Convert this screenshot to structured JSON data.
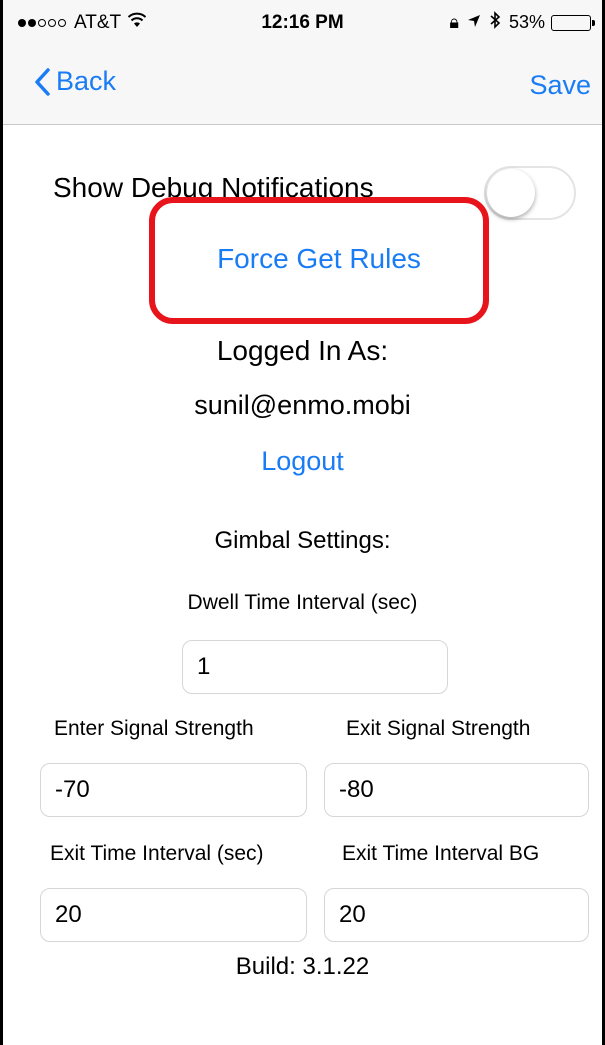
{
  "status_bar": {
    "carrier": "AT&T",
    "time": "12:16 PM",
    "battery_percent": "53%",
    "battery_level": 0.53,
    "icons": [
      "signal-dots-icon",
      "wifi-icon",
      "rotation-lock-icon",
      "location-icon",
      "bluetooth-icon",
      "battery-icon"
    ]
  },
  "nav": {
    "back_label": "Back",
    "save_label": "Save"
  },
  "settings": {
    "debug_label": "Show Debug Notifications",
    "debug_enabled": false,
    "force_get_rules_label": "Force Get Rules",
    "logged_in_label": "Logged In As:",
    "email": "sunil@enmo.mobi",
    "logout_label": "Logout"
  },
  "gimbal": {
    "title": "Gimbal Settings:",
    "dwell_label": "Dwell Time Interval (sec)",
    "dwell_value": "1",
    "enter_signal_label": "Enter Signal Strength",
    "enter_signal_value": "-70",
    "exit_signal_label": "Exit Signal Strength",
    "exit_signal_value": "-80",
    "exit_time_label": "Exit Time Interval (sec)",
    "exit_time_value": "20",
    "exit_time_bg_label": "Exit Time Interval BG",
    "exit_time_bg_value": "20"
  },
  "footer": {
    "build": "Build: 3.1.22"
  },
  "colors": {
    "accent": "#1a7cf5",
    "highlight": "#e8141c"
  }
}
